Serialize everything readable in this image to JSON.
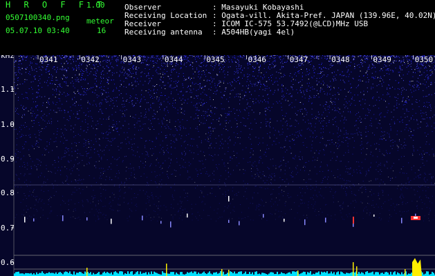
{
  "app": {
    "title": "H R O F F T",
    "version": "1.00"
  },
  "file": {
    "name": "0507100340.png",
    "datetime": "05.07.10 03:40"
  },
  "meteor": {
    "label": "meteor",
    "count": "16"
  },
  "info": [
    {
      "key": "Observer",
      "value": ": Masayuki Kobayashi"
    },
    {
      "key": "Receiving Location",
      "value": ": Ogata-vill. Akita-Pref. JAPAN (139.96E, 40.02N)"
    },
    {
      "key": "Receiver",
      "value": ": ICOM IC-575 53.7492(@LCD)MHz USB"
    },
    {
      "key": "Receiving antenna",
      "value": ": A504HB(yagi 4el)"
    }
  ],
  "plot": {
    "unit": "kHz",
    "time_ticks": [
      "0341",
      "0342",
      "0343",
      "0344",
      "0345",
      "0346",
      "0347",
      "0348",
      "0349",
      "0350"
    ],
    "freq_ticks": [
      "1.1",
      "1.0",
      "0.9",
      "0.8",
      "0.7",
      "0.6"
    ],
    "colors": {
      "background": "#06062a",
      "noise": "#2a2aff",
      "meteor": "#ff3333",
      "signal": "#ffee00",
      "level": "#00e0ff",
      "grid": "#888888",
      "text": "#ffffff"
    }
  }
}
